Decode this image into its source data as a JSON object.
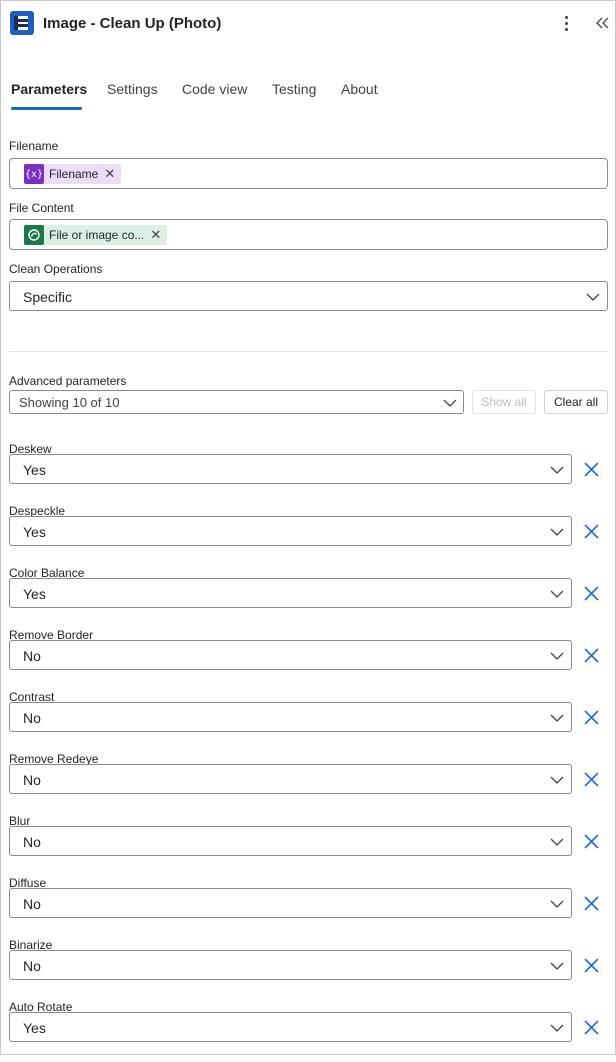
{
  "header": {
    "title": "Image - Clean Up (Photo)",
    "app_icon": "encodian-logo-icon",
    "more_icon": "more-vertical-icon",
    "collapse_icon": "double-chevron-left-icon"
  },
  "tabs": [
    {
      "label": "Parameters",
      "active": true
    },
    {
      "label": "Settings",
      "active": false
    },
    {
      "label": "Code view",
      "active": false
    },
    {
      "label": "Testing",
      "active": false
    },
    {
      "label": "About",
      "active": false
    }
  ],
  "filename": {
    "label": "Filename",
    "token": {
      "text": "Filename",
      "icon": "variable-icon",
      "icon_glyph": "{x}",
      "remove": "✕"
    }
  },
  "file_content": {
    "label": "File Content",
    "token": {
      "text": "File or image co...",
      "icon": "sharepoint-connector-icon",
      "remove": "✕"
    }
  },
  "clean_operations": {
    "label": "Clean Operations",
    "value": "Specific"
  },
  "advanced": {
    "label": "Advanced parameters",
    "selector_value": "Showing 10 of 10",
    "show_all_label": "Show all",
    "clear_all_label": "Clear all"
  },
  "params": [
    {
      "label": "Deskew",
      "value": "Yes"
    },
    {
      "label": "Despeckle",
      "value": "Yes"
    },
    {
      "label": "Color Balance",
      "value": "Yes"
    },
    {
      "label": "Remove Border",
      "value": "No"
    },
    {
      "label": "Contrast",
      "value": "No"
    },
    {
      "label": "Remove Redeye",
      "value": "No"
    },
    {
      "label": "Blur",
      "value": "No"
    },
    {
      "label": "Diffuse",
      "value": "No"
    },
    {
      "label": "Binarize",
      "value": "No"
    },
    {
      "label": "Auto Rotate",
      "value": "Yes"
    }
  ],
  "colors": {
    "accent": "#0f6cbd",
    "remove_icon": "#1f6fd9",
    "variable_token": "#7b2fbe",
    "connector_token": "#1b7a45"
  }
}
